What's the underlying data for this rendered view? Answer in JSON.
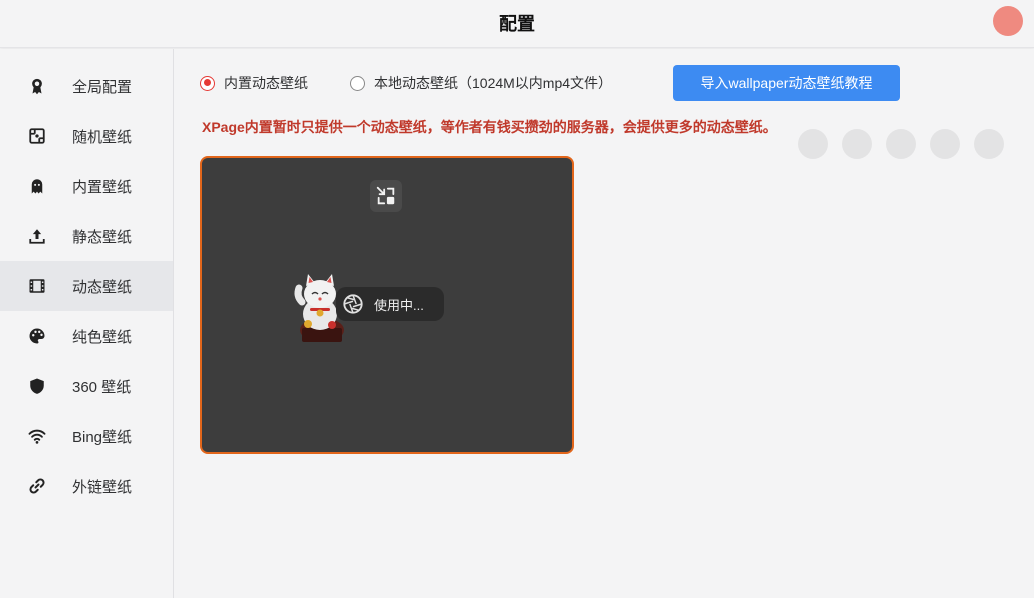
{
  "window": {
    "title": "配置"
  },
  "sidebar": {
    "items": [
      {
        "label": "全局配置",
        "icon": "award-icon"
      },
      {
        "label": "随机壁纸",
        "icon": "shuffle-icon"
      },
      {
        "label": "内置壁纸",
        "icon": "ghost-icon"
      },
      {
        "label": "静态壁纸",
        "icon": "upload-icon"
      },
      {
        "label": "动态壁纸",
        "icon": "film-icon"
      },
      {
        "label": "纯色壁纸",
        "icon": "palette-icon"
      },
      {
        "label": "360 壁纸",
        "icon": "shield-icon"
      },
      {
        "label": "Bing壁纸",
        "icon": "wifi-icon"
      },
      {
        "label": "外链壁纸",
        "icon": "link-icon"
      }
    ],
    "active_index": 4
  },
  "options": {
    "builtin_label": "内置动态壁纸",
    "local_label": "本地动态壁纸（1024M以内mp4文件）",
    "selected": "builtin"
  },
  "import_button": {
    "label": "导入wallpaper动态壁纸教程"
  },
  "notice": "XPage内置暂时只提供一个动态壁纸，等作者有钱买攒劲的服务器，会提供更多的动态壁纸。",
  "wallpaper_card": {
    "status": "使用中...",
    "border_color": "#e2661b"
  },
  "colors": {
    "accent_red": "#e53935",
    "button_blue": "#3d8bf2",
    "close_dot": "#ef8a80",
    "active_bg": "#e6e7ea"
  }
}
